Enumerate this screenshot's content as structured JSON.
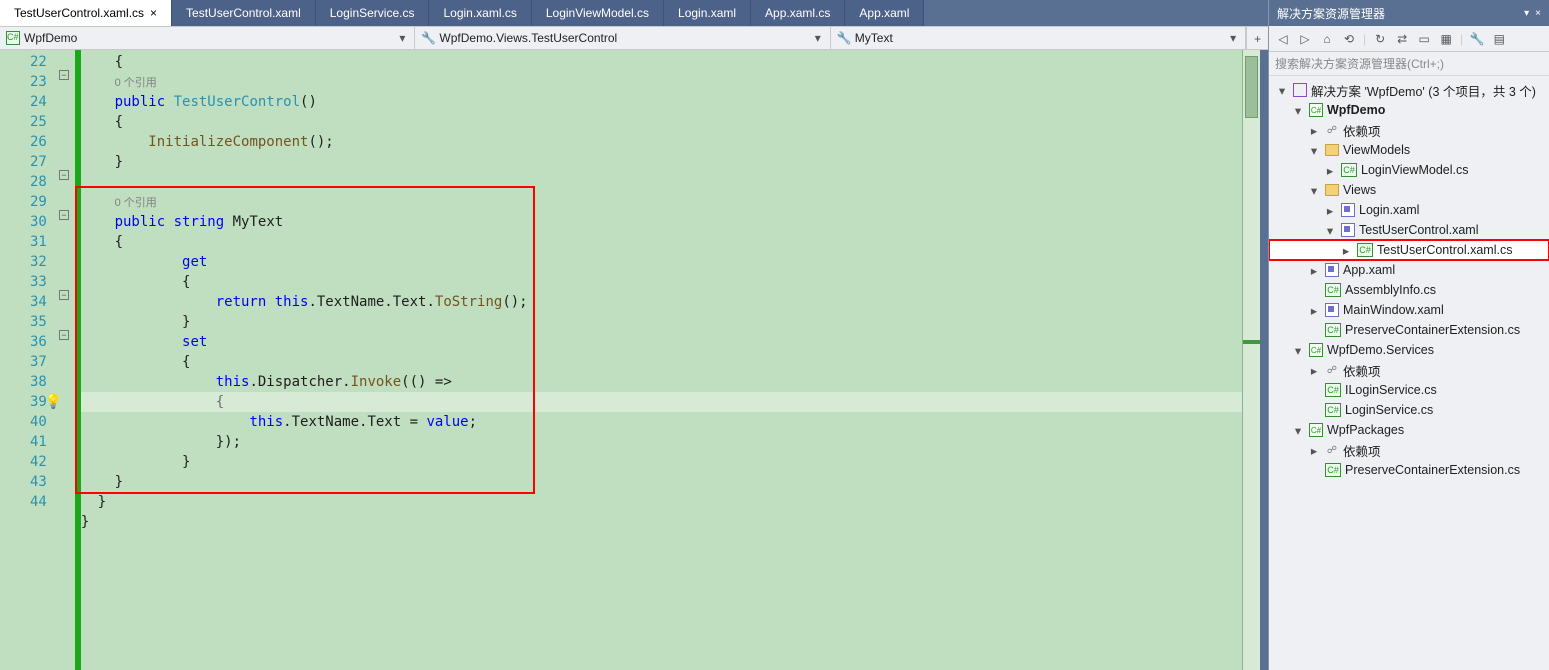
{
  "tabs": [
    {
      "label": "TestUserControl.xaml.cs",
      "active": true,
      "closable": true
    },
    {
      "label": "TestUserControl.xaml"
    },
    {
      "label": "LoginService.cs"
    },
    {
      "label": "Login.xaml.cs"
    },
    {
      "label": "LoginViewModel.cs"
    },
    {
      "label": "Login.xaml"
    },
    {
      "label": "App.xaml.cs"
    },
    {
      "label": "App.xaml"
    }
  ],
  "nav": {
    "scope": "WpfDemo",
    "type": "WpfDemo.Views.TestUserControl",
    "member": "MyText"
  },
  "code": {
    "lines": [
      22,
      23,
      24,
      25,
      26,
      27,
      28,
      29,
      30,
      31,
      32,
      33,
      34,
      35,
      36,
      37,
      38,
      39,
      40,
      41,
      42,
      43,
      44
    ],
    "codelens": "0 个引用",
    "tokens": {
      "public": "public",
      "string": "string",
      "get": "get",
      "set": "set",
      "return": "return",
      "this": "this",
      "value": "value"
    },
    "idents": {
      "TestUserControl": "TestUserControl",
      "InitializeComponent": "InitializeComponent",
      "MyText": "MyText",
      "TextName": "TextName",
      "Text": "Text",
      "ToString": "ToString",
      "Dispatcher": "Dispatcher",
      "Invoke": "Invoke"
    }
  },
  "solution": {
    "title": "解决方案资源管理器",
    "searchPlaceholder": "搜索解决方案资源管理器(Ctrl+;)",
    "root": "解决方案 'WpfDemo' (3 个项目，共 3 个)",
    "tree": [
      {
        "d": 0,
        "exp": "▾",
        "icon": "sol",
        "label": "解决方案 'WpfDemo' (3 个项目，共 3 个)",
        "name": "solution-node"
      },
      {
        "d": 1,
        "exp": "▾",
        "icon": "proj",
        "label": "WpfDemo",
        "bold": true,
        "name": "project-wpfdemo"
      },
      {
        "d": 2,
        "exp": "▸",
        "icon": "dep",
        "label": "依赖项",
        "name": "dependencies"
      },
      {
        "d": 2,
        "exp": "▾",
        "icon": "fold",
        "label": "ViewModels",
        "name": "folder-viewmodels"
      },
      {
        "d": 3,
        "exp": "▸",
        "icon": "cs",
        "label": "LoginViewModel.cs",
        "name": "file-loginviewmodel"
      },
      {
        "d": 2,
        "exp": "▾",
        "icon": "fold",
        "label": "Views",
        "name": "folder-views"
      },
      {
        "d": 3,
        "exp": "▸",
        "icon": "xaml",
        "label": "Login.xaml",
        "name": "file-login-xaml"
      },
      {
        "d": 3,
        "exp": "▾",
        "icon": "xaml",
        "label": "TestUserControl.xaml",
        "name": "file-testusercontrol-xaml"
      },
      {
        "d": 4,
        "exp": "▸",
        "icon": "cs",
        "label": "TestUserControl.xaml.cs",
        "sel": true,
        "name": "file-testusercontrol-cs"
      },
      {
        "d": 2,
        "exp": "▸",
        "icon": "xaml",
        "label": "App.xaml",
        "name": "file-app-xaml"
      },
      {
        "d": 2,
        "exp": "",
        "icon": "cs",
        "label": "AssemblyInfo.cs",
        "name": "file-assemblyinfo"
      },
      {
        "d": 2,
        "exp": "▸",
        "icon": "xaml",
        "label": "MainWindow.xaml",
        "name": "file-mainwindow"
      },
      {
        "d": 2,
        "exp": "",
        "icon": "cs",
        "label": "PreserveContainerExtension.cs",
        "name": "file-preserve1"
      },
      {
        "d": 1,
        "exp": "▾",
        "icon": "proj",
        "label": "WpfDemo.Services",
        "name": "project-services"
      },
      {
        "d": 2,
        "exp": "▸",
        "icon": "dep",
        "label": "依赖项",
        "name": "dependencies-2"
      },
      {
        "d": 2,
        "exp": "",
        "icon": "cs",
        "label": "ILoginService.cs",
        "name": "file-iloginservice"
      },
      {
        "d": 2,
        "exp": "",
        "icon": "cs",
        "label": "LoginService.cs",
        "name": "file-loginservice"
      },
      {
        "d": 1,
        "exp": "▾",
        "icon": "proj",
        "label": "WpfPackages",
        "name": "project-wpfpackages"
      },
      {
        "d": 2,
        "exp": "▸",
        "icon": "dep",
        "label": "依赖项",
        "name": "dependencies-3"
      },
      {
        "d": 2,
        "exp": "",
        "icon": "cs",
        "label": "PreserveContainerExtension.cs",
        "name": "file-preserve2"
      }
    ]
  }
}
